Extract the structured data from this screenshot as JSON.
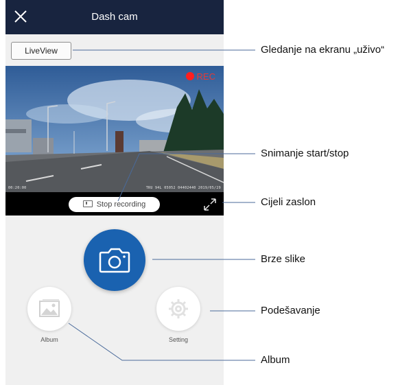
{
  "app": {
    "title": "Dash cam",
    "liveview_label": "LiveView",
    "rec_label": "REC",
    "osd_text": "00:20:00   ",
    "osd_right": "TRU 94L 05052  04402440 2019/05/29",
    "stop_recording_label": "Stop recording",
    "album_label": "Album",
    "setting_label": "Setting"
  },
  "icons": {
    "close": "close-icon",
    "rec": "record-dot-icon",
    "stop_recording": "video-camera-icon",
    "fullscreen": "expand-icon",
    "photo": "camera-icon",
    "album": "image-icon",
    "setting": "gear-icon"
  },
  "colors": {
    "topbar": "#18243f",
    "photo_button": "#1a62b0",
    "rec": "#ff1e1e"
  },
  "annotations": {
    "liveview": "Gledanje na ekranu „uživo“",
    "record": "Snimanje start/stop",
    "fullscreen": "Cijeli zaslon",
    "photo": "Brze slike",
    "setting": "Podešavanje",
    "album": "Album"
  }
}
